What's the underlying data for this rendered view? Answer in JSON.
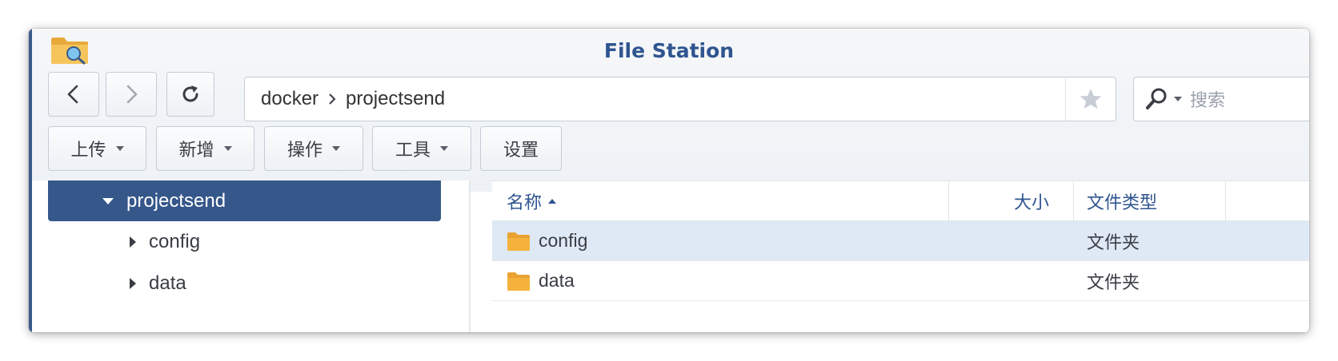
{
  "window": {
    "title": "File Station"
  },
  "path": {
    "segments": [
      "docker",
      "projectsend"
    ]
  },
  "search": {
    "placeholder": "搜索"
  },
  "toolbar": {
    "upload": "上传",
    "create": "新增",
    "action": "操作",
    "tools": "工具",
    "settings": "设置"
  },
  "tree": {
    "selected": "projectsend",
    "children": [
      "config",
      "data"
    ]
  },
  "list": {
    "columns": {
      "name": "名称",
      "size": "大小",
      "type": "文件类型"
    },
    "rows": [
      {
        "name": "config",
        "size": "",
        "type": "文件夹",
        "selected": true
      },
      {
        "name": "data",
        "size": "",
        "type": "文件夹",
        "selected": false
      }
    ]
  },
  "colors": {
    "accent": "#35578a",
    "title": "#2f5590",
    "selected_row": "#dfe9f6",
    "folder": "#f5b23c"
  },
  "icons": [
    "file-station-app-icon",
    "back-arrow-icon",
    "forward-arrow-icon",
    "refresh-icon",
    "chevron-right-icon",
    "star-icon",
    "search-icon",
    "folder-icon"
  ]
}
